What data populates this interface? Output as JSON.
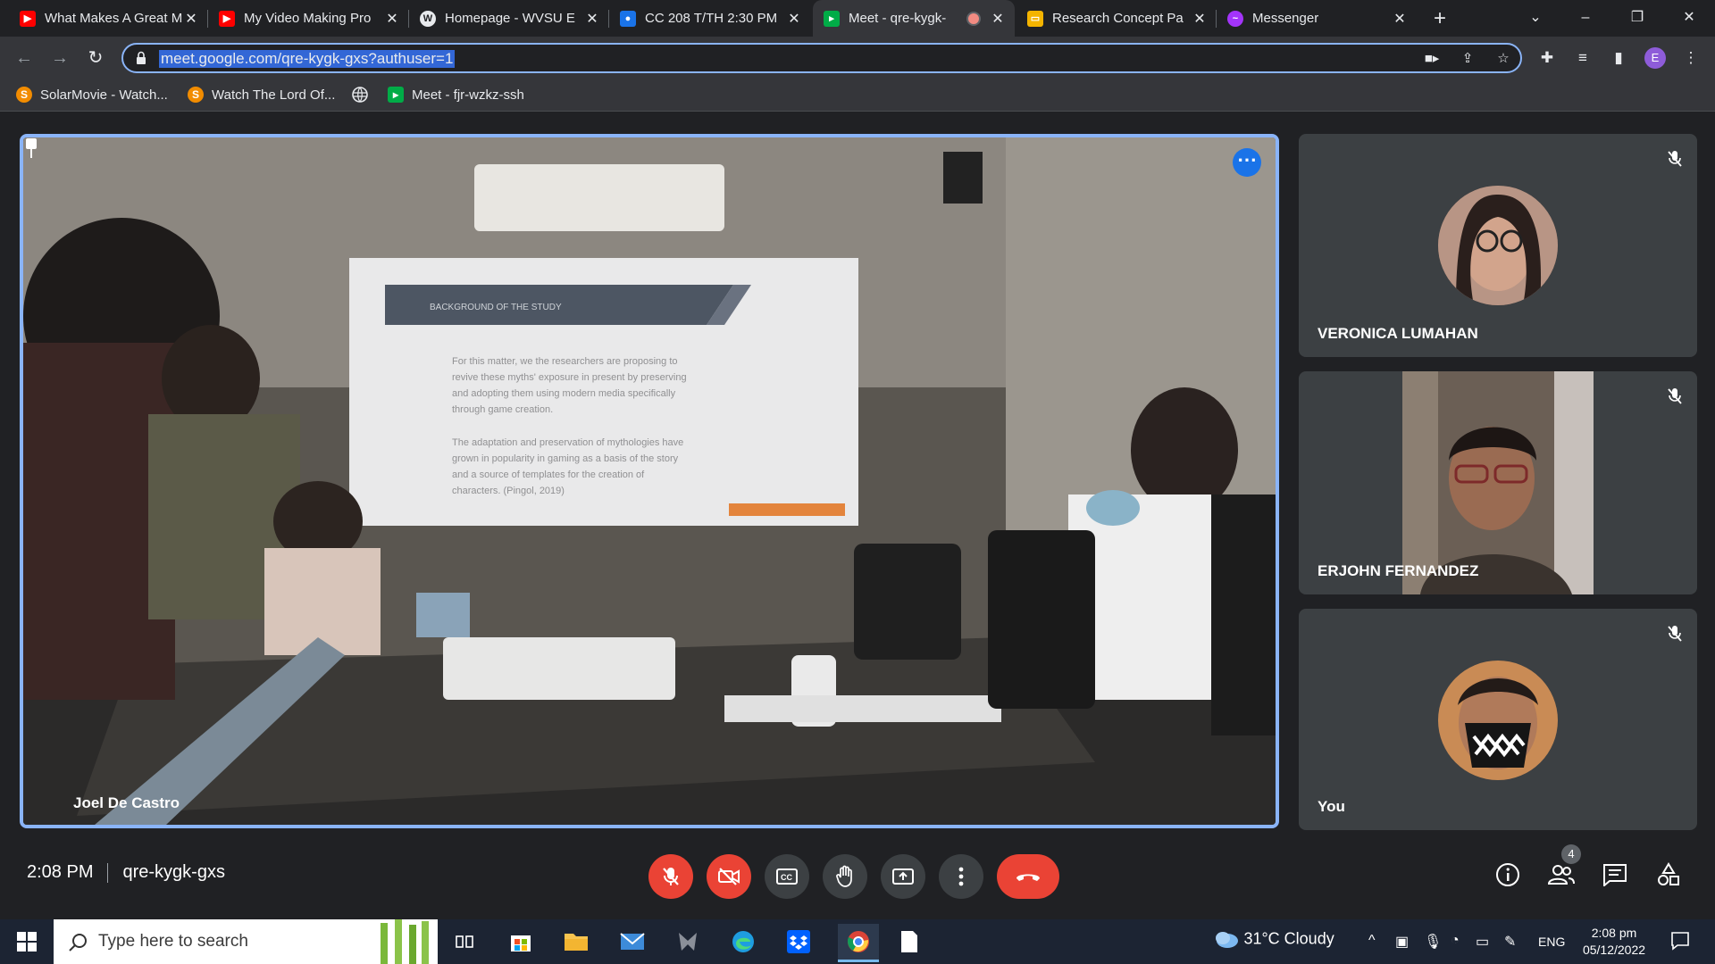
{
  "browser": {
    "tabs": [
      {
        "title": "What Makes A Great M",
        "favicon": "youtube-icon",
        "color": "#ff0000"
      },
      {
        "title": "My Video Making Pro",
        "favicon": "youtube-icon",
        "color": "#ff0000"
      },
      {
        "title": "Homepage - WVSU E",
        "favicon": "wvsu-icon",
        "color": "#e8eaed"
      },
      {
        "title": "CC 208 T/TH 2:30 PM",
        "favicon": "classroom-icon",
        "color": "#1a73e8"
      },
      {
        "title": "Meet - qre-kygk-",
        "favicon": "meet-icon",
        "color": "#00ac47",
        "recording": true,
        "active": true
      },
      {
        "title": "Research Concept Pa",
        "favicon": "slides-icon",
        "color": "#f4b400"
      },
      {
        "title": "Messenger",
        "favicon": "messenger-icon",
        "color": "#a334fa"
      }
    ],
    "close_glyph": "✕",
    "url": "meet.google.com/qre-kygk-gxs?authuser=1",
    "profile_initial": "E",
    "bookmarks": [
      {
        "label": "SolarMovie - Watch...",
        "icon": "solarmovie-icon",
        "letter": "S"
      },
      {
        "label": "Watch The Lord Of...",
        "icon": "solarmovie-icon",
        "letter": "S"
      },
      {
        "label": "",
        "icon": "globe-icon",
        "letter": ""
      },
      {
        "label": "Meet - fjr-wzkz-ssh",
        "icon": "meet-icon",
        "letter": ""
      }
    ]
  },
  "meet": {
    "main_participant": "Joel De Castro",
    "slide": {
      "heading": "BACKGROUND OF THE STUDY",
      "bullet1": [
        "For this matter, we the researchers are proposing to",
        "revive these myths' exposure in present by preserving",
        "and adopting them using modern media specifically",
        "through game creation."
      ],
      "bullet2": [
        "The adaptation and preservation of mythologies have",
        "grown in popularity in gaming as a basis of the story",
        "and a source of templates for the creation of",
        "characters. (Pingol, 2019)"
      ]
    },
    "participants": [
      {
        "name": "VERONICA LUMAHAN",
        "muted": true
      },
      {
        "name": "ERJOHN FERNANDEZ",
        "muted": true
      },
      {
        "name": "You",
        "muted": true
      }
    ],
    "time": "2:08 PM",
    "meeting_code": "qre-kygk-gxs",
    "people_count": "4",
    "accent_red": "#ea4335",
    "accent_blue": "#8ab4f8"
  },
  "taskbar": {
    "search_placeholder": "Type here to search",
    "weather": "31°C  Cloudy",
    "language": "ENG",
    "clock_time": "2:08 pm",
    "clock_date": "05/12/2022"
  }
}
